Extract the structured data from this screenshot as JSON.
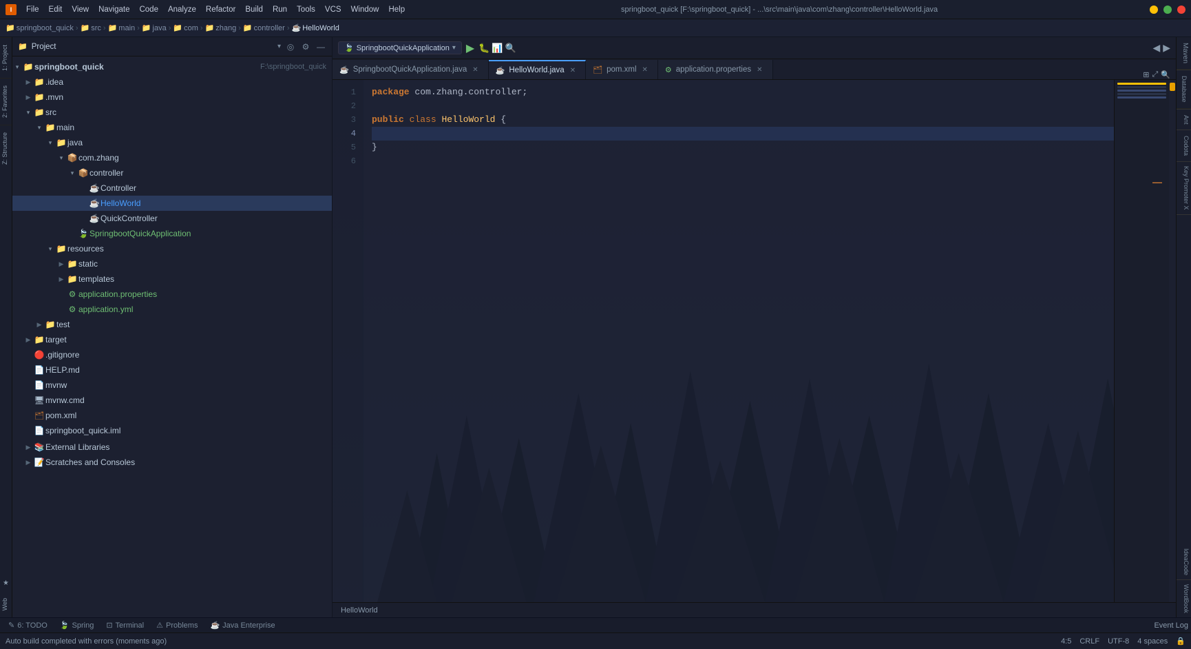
{
  "titlebar": {
    "app_name": "springboot_quick",
    "path": "F:\\springboot_quick",
    "full_title": "springboot_quick [F:\\springboot_quick] - ...\\src\\main\\java\\com\\zhang\\controller\\HelloWorld.java",
    "menu_items": [
      "File",
      "Edit",
      "View",
      "Navigate",
      "Code",
      "Analyze",
      "Refactor",
      "Build",
      "Run",
      "Tools",
      "VCS",
      "Window",
      "Help"
    ],
    "min_label": "—",
    "max_label": "□",
    "close_label": "✕"
  },
  "breadcrumb": {
    "items": [
      {
        "label": "springboot_quick",
        "icon": "folder"
      },
      {
        "label": "src",
        "icon": "folder"
      },
      {
        "label": "main",
        "icon": "folder"
      },
      {
        "label": "java",
        "icon": "folder"
      },
      {
        "label": "com",
        "icon": "folder"
      },
      {
        "label": "zhang",
        "icon": "folder"
      },
      {
        "label": "controller",
        "icon": "folder"
      },
      {
        "label": "HelloWorld",
        "icon": "java"
      }
    ]
  },
  "project_panel": {
    "title": "Project",
    "dropdown_arrow": "▾",
    "root": {
      "name": "springboot_quick",
      "path": "F:\\springboot_quick",
      "children": [
        {
          "name": ".idea",
          "type": "folder",
          "expanded": false
        },
        {
          "name": ".mvn",
          "type": "folder",
          "expanded": false
        },
        {
          "name": "src",
          "type": "folder",
          "expanded": true,
          "children": [
            {
              "name": "main",
              "type": "folder",
              "expanded": true,
              "children": [
                {
                  "name": "java",
                  "type": "folder",
                  "expanded": true,
                  "children": [
                    {
                      "name": "com.zhang",
                      "type": "package",
                      "expanded": true,
                      "children": [
                        {
                          "name": "controller",
                          "type": "package",
                          "expanded": true,
                          "children": [
                            {
                              "name": "Controller",
                              "type": "java-spring"
                            },
                            {
                              "name": "HelloWorld",
                              "type": "java",
                              "selected": true
                            },
                            {
                              "name": "QuickController",
                              "type": "java-spring"
                            }
                          ]
                        },
                        {
                          "name": "SpringbootQuickApplication",
                          "type": "java-spring"
                        }
                      ]
                    }
                  ]
                },
                {
                  "name": "resources",
                  "type": "folder",
                  "expanded": true,
                  "children": [
                    {
                      "name": "static",
                      "type": "folder",
                      "expanded": false
                    },
                    {
                      "name": "templates",
                      "type": "folder",
                      "expanded": false
                    },
                    {
                      "name": "application.properties",
                      "type": "properties"
                    },
                    {
                      "name": "application.yml",
                      "type": "yaml"
                    }
                  ]
                }
              ]
            },
            {
              "name": "test",
              "type": "folder",
              "expanded": false
            }
          ]
        },
        {
          "name": "target",
          "type": "folder",
          "expanded": false
        },
        {
          "name": ".gitignore",
          "type": "git"
        },
        {
          "name": "HELP.md",
          "type": "md"
        },
        {
          "name": "mvnw",
          "type": "file"
        },
        {
          "name": "mvnw.cmd",
          "type": "bat"
        },
        {
          "name": "pom.xml",
          "type": "xml"
        },
        {
          "name": "springboot_quick.iml",
          "type": "iml"
        }
      ]
    },
    "external_libraries": "External Libraries",
    "scratches": "Scratches and Consoles"
  },
  "editor": {
    "tabs": [
      {
        "label": "SpringbootQuickApplication.java",
        "type": "java",
        "active": false
      },
      {
        "label": "HelloWorld.java",
        "type": "java",
        "active": true
      },
      {
        "label": "pom.xml",
        "type": "xml",
        "active": false
      },
      {
        "label": "application.properties",
        "type": "properties",
        "active": false
      }
    ],
    "active_file": "HelloWorld.java",
    "code_lines": [
      {
        "num": 1,
        "content": "package com.zhang.controller;",
        "type": "code"
      },
      {
        "num": 2,
        "content": "",
        "type": "empty"
      },
      {
        "num": 3,
        "content": "public class HelloWorld {",
        "type": "code"
      },
      {
        "num": 4,
        "content": "",
        "type": "empty"
      },
      {
        "num": 5,
        "content": "}",
        "type": "code"
      },
      {
        "num": 6,
        "content": "",
        "type": "empty"
      }
    ],
    "footer_label": "HelloWorld",
    "cursor_pos": "4:5",
    "line_ending": "CRLF",
    "encoding": "UTF-8",
    "indent": "4 spaces"
  },
  "bottom_tabs": [
    {
      "label": "6: TODO",
      "icon": "✎",
      "active": false
    },
    {
      "label": "Spring",
      "icon": "🍃",
      "active": false
    },
    {
      "label": "Terminal",
      "icon": "⊡",
      "active": false
    },
    {
      "label": "⚠ Problems",
      "icon": "",
      "active": false
    },
    {
      "label": "Java Enterprise",
      "icon": "☕",
      "active": false
    }
  ],
  "status": {
    "message": "Auto build completed with errors (moments ago)",
    "event_log": "Event Log",
    "cursor": "4:5",
    "line_ending": "CRLF",
    "encoding": "UTF-8",
    "indent": "4 spaces"
  },
  "right_panel_tabs": [
    "Maven",
    "Database",
    "Ant",
    "Codota",
    "Key Promoter X",
    "IdeaCode",
    "WordBook"
  ],
  "left_panel_tabs": [
    "1: Project",
    "2: Favorites",
    "Z: Structure"
  ]
}
